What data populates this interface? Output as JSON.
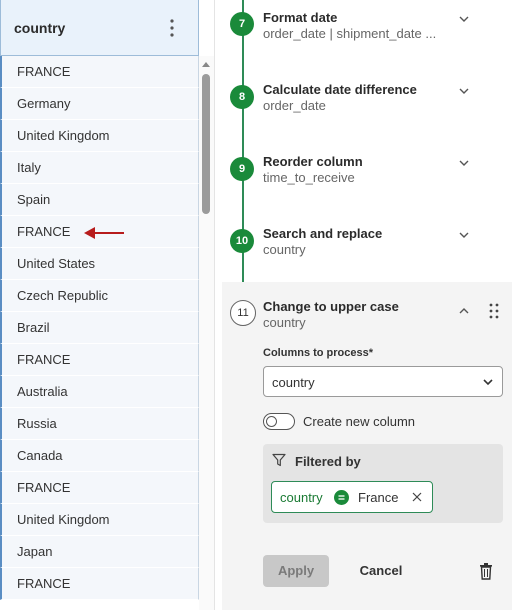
{
  "column": {
    "name": "country",
    "menu_icon": "kebab-vertical-icon",
    "values": [
      "FRANCE",
      "Germany",
      "United Kingdom",
      "Italy",
      "Spain",
      "FRANCE",
      "United States",
      "Czech Republic",
      "Brazil",
      "FRANCE",
      "Australia",
      "Russia",
      "Canada",
      "FRANCE",
      "United Kingdom",
      "Japan",
      "FRANCE"
    ],
    "highlight_arrow_color": "#b71c1c"
  },
  "steps": [
    {
      "number": "7",
      "title": "Format date",
      "subtitle": "order_date | shipment_date ..."
    },
    {
      "number": "8",
      "title": "Calculate date difference",
      "subtitle": "order_date"
    },
    {
      "number": "9",
      "title": "Reorder column",
      "subtitle": "time_to_receive"
    },
    {
      "number": "10",
      "title": "Search and replace",
      "subtitle": "country"
    }
  ],
  "active_step": {
    "number": "11",
    "title": "Change to upper case",
    "subtitle": "country",
    "columns_label": "Columns to process*",
    "columns_value": "country",
    "toggle_label": "Create new column",
    "toggle_on": false,
    "filter_title": "Filtered by",
    "filter": {
      "column": "country",
      "operator": "=",
      "value": "France"
    },
    "apply_label": "Apply",
    "cancel_label": "Cancel"
  },
  "colors": {
    "accent_green": "#1a8a3a",
    "column_blue": "#5a8dc3"
  }
}
